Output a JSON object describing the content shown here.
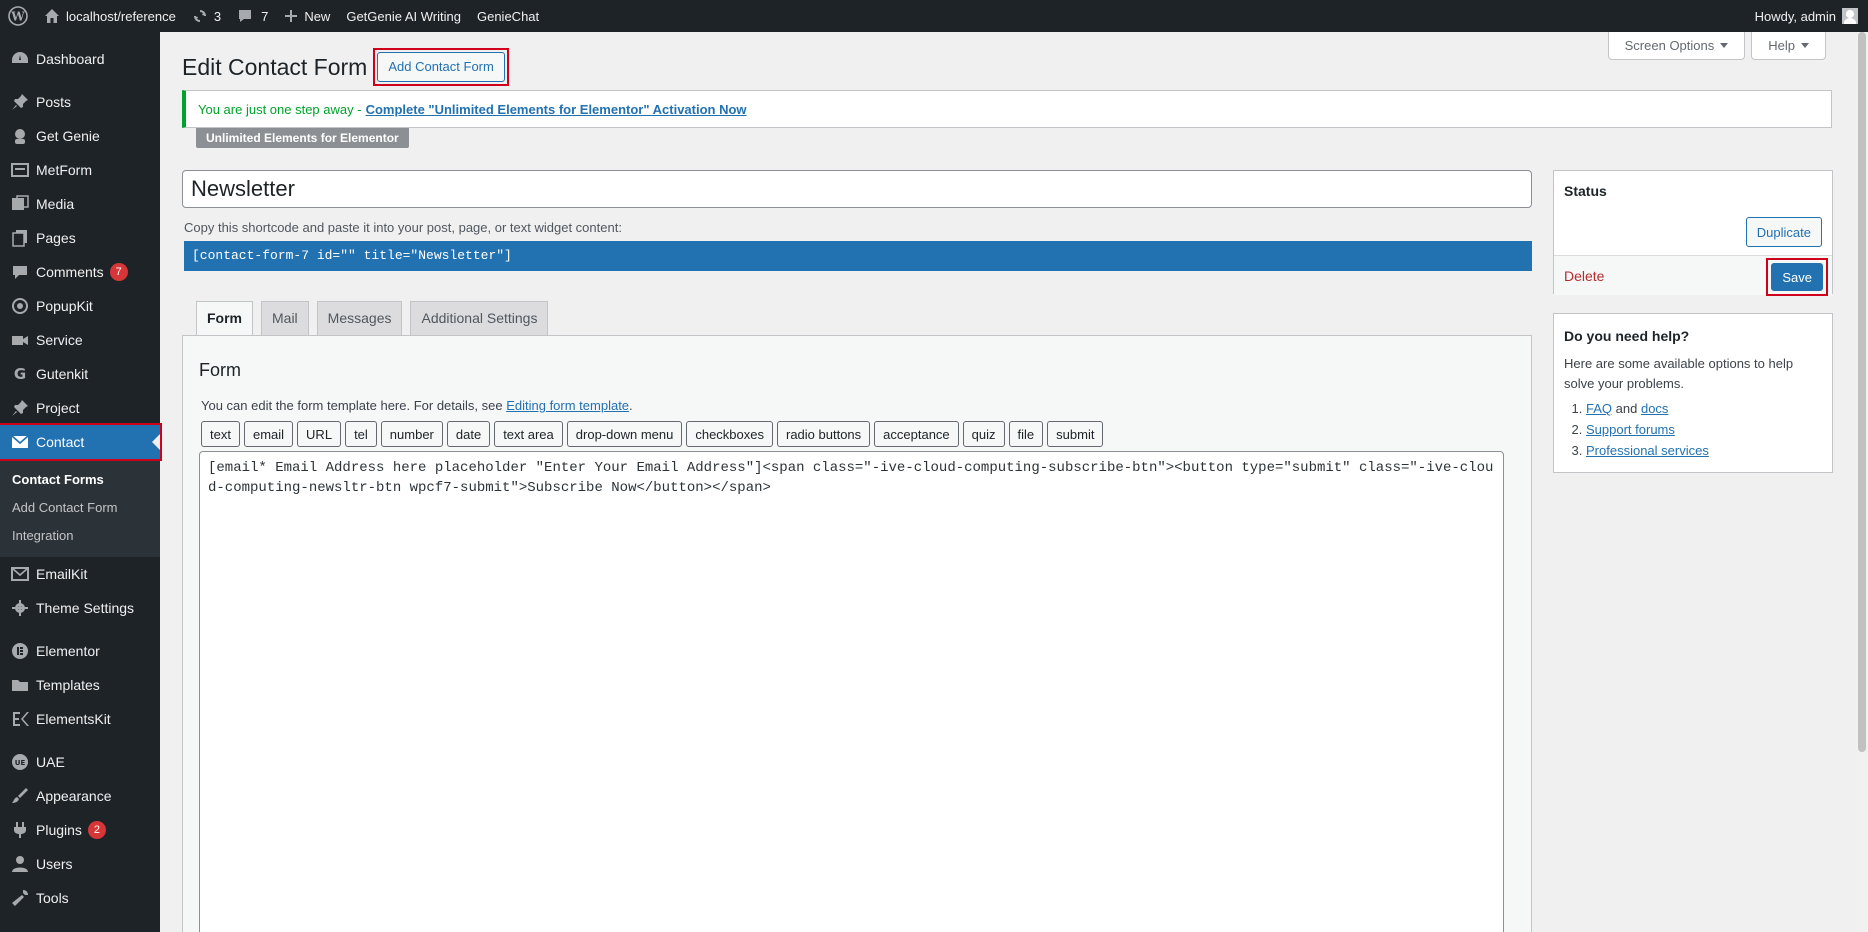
{
  "adminbar": {
    "site": "localhost/reference",
    "updates": "3",
    "comments": "7",
    "new_label": "New",
    "getgenie": "GetGenie AI Writing",
    "geniechat": "GenieChat",
    "howdy": "Howdy, admin"
  },
  "sidebar": {
    "items": [
      {
        "label": "Dashboard",
        "icon": "dashboard-icon"
      },
      {
        "label": "Posts",
        "icon": "pin-icon"
      },
      {
        "label": "Get Genie",
        "icon": "genie-icon"
      },
      {
        "label": "MetForm",
        "icon": "form-icon"
      },
      {
        "label": "Media",
        "icon": "media-icon"
      },
      {
        "label": "Pages",
        "icon": "pages-icon"
      },
      {
        "label": "Comments",
        "icon": "comment-icon",
        "badge": "7"
      },
      {
        "label": "PopupKit",
        "icon": "popup-icon"
      },
      {
        "label": "Service",
        "icon": "camera-icon"
      },
      {
        "label": "Gutenkit",
        "icon": "gutenkit-icon"
      },
      {
        "label": "Project",
        "icon": "pin-icon"
      },
      {
        "label": "Contact",
        "icon": "mail-icon"
      },
      {
        "label": "EmailKit",
        "icon": "mail-icon"
      },
      {
        "label": "Theme Settings",
        "icon": "gear-icon"
      },
      {
        "label": "Elementor",
        "icon": "elementor-icon"
      },
      {
        "label": "Templates",
        "icon": "folder-icon"
      },
      {
        "label": "ElementsKit",
        "icon": "elementskit-icon"
      },
      {
        "label": "UAE",
        "icon": "uae-icon"
      },
      {
        "label": "Appearance",
        "icon": "brush-icon"
      },
      {
        "label": "Plugins",
        "icon": "plugin-icon",
        "badge": "2"
      },
      {
        "label": "Users",
        "icon": "user-icon"
      },
      {
        "label": "Tools",
        "icon": "wrench-icon"
      }
    ],
    "submenu": [
      "Contact Forms",
      "Add Contact Form",
      "Integration"
    ]
  },
  "screen_options": "Screen Options",
  "help": "Help",
  "page_title": "Edit Contact Form",
  "add_new": "Add Contact Form",
  "notice": {
    "text": "You are just one step away -",
    "link": "Complete \"Unlimited Elements for Elementor\" Activation Now"
  },
  "plugin_tag": "Unlimited Elements for Elementor",
  "form_title": "Newsletter",
  "shortcode_label": "Copy this shortcode and paste it into your post, page, or text widget content:",
  "shortcode": "[contact-form-7 id=\"\" title=\"Newsletter\"]",
  "tabs": [
    "Form",
    "Mail",
    "Messages",
    "Additional Settings"
  ],
  "form_panel": {
    "heading": "Form",
    "desc": "You can edit the form template here. For details, see",
    "desc_link": "Editing form template",
    "desc_end": ".",
    "tag_buttons": [
      "text",
      "email",
      "URL",
      "tel",
      "number",
      "date",
      "text area",
      "drop-down menu",
      "checkboxes",
      "radio buttons",
      "acceptance",
      "quiz",
      "file",
      "submit"
    ],
    "template": "[email* Email Address here placeholder \"Enter Your Email Address\"]<span class=\"-ive-cloud-computing-subscribe-btn\"><button type=\"submit\" class=\"-ive-cloud-computing-newsltr-btn wpcf7-submit\">Subscribe Now</button></span>"
  },
  "status_box": {
    "title": "Status",
    "duplicate": "Duplicate",
    "delete": "Delete",
    "save": "Save"
  },
  "help_box": {
    "title": "Do you need help?",
    "text": "Here are some available options to help solve your problems.",
    "faq": "FAQ",
    "and": "and",
    "docs": "docs",
    "support": "Support forums",
    "professional": "Professional services"
  }
}
